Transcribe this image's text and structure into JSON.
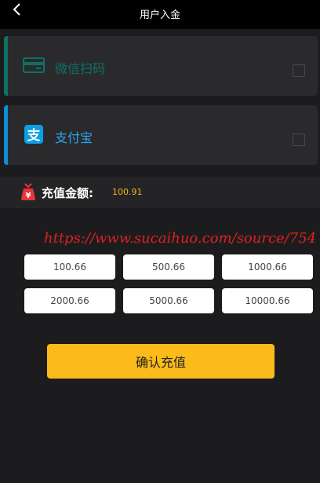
{
  "header": {
    "title": "用户入金"
  },
  "payment_methods": [
    {
      "label": "微信扫码",
      "icon": "card-icon"
    },
    {
      "label": "支付宝",
      "icon": "alipay-icon"
    }
  ],
  "amount": {
    "label": "充值金额:",
    "value": "100.91"
  },
  "watermark": "https://www.sucaihuo.com/source/754",
  "presets": [
    "100.66",
    "500.66",
    "1000.66",
    "2000.66",
    "5000.66",
    "10000.66"
  ],
  "confirm_label": "确认充值",
  "colors": {
    "wechat": "#0e7163",
    "alipay": "#27a7f0",
    "accent_yellow": "#fbbb1a",
    "amount": "#f5b31a"
  }
}
